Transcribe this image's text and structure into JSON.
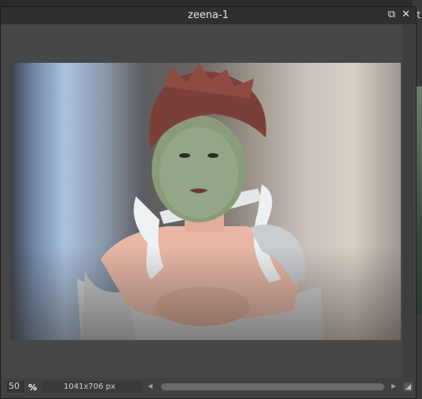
{
  "window": {
    "title": "zeena-1"
  },
  "controls": {
    "restore": "⧉",
    "close": "✕"
  },
  "status": {
    "zoom": "50",
    "zoom_unit": "%",
    "dimensions": "1041x706 px"
  },
  "background": {
    "right_text": "it"
  },
  "colors": {
    "titlebar": "#2f2f2f",
    "panel": "#464646",
    "status": "#414141",
    "scroll_thumb": "#6a6a6a"
  },
  "image": {
    "alt": "3D render of a woman in white outfit"
  }
}
